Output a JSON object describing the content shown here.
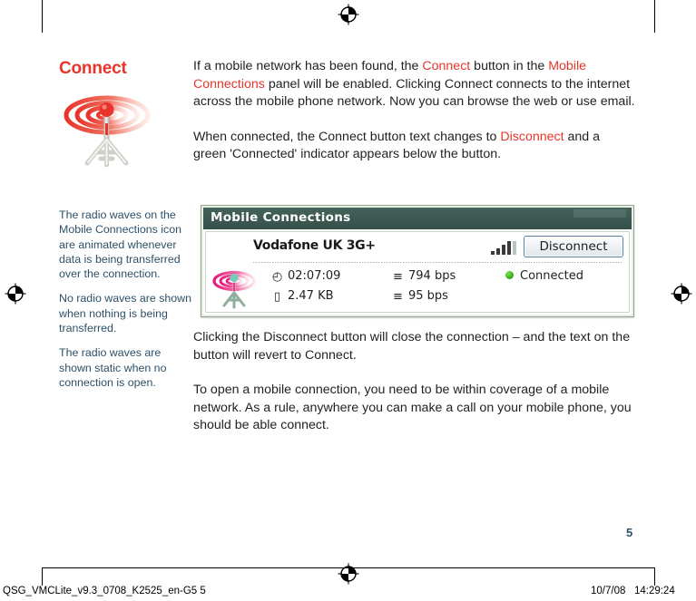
{
  "page": {
    "number": "5",
    "footer_left": "QSG_VMCLite_v9.3_0708_K2525_en-G5   5",
    "footer_right": "10/7/08   14:29:24"
  },
  "section": {
    "heading": "Connect",
    "illustration_icon": "radio-antenna-icon"
  },
  "body": {
    "paragraph1": {
      "part1": "If a mobile network has been found, the ",
      "hl1": "Connect",
      "part2": " button in the ",
      "hl2": "Mobile Connections",
      "part3": " panel will be enabled. Clicking Connect connects to the internet across the mobile phone network. Now you can browse the web or use email."
    },
    "paragraph2": {
      "part1": "When connected, the Connect button text changes to ",
      "hl1": "Disconnect",
      "part2": " and a green 'Connected' indicator appears below the button."
    },
    "paragraph3": "Clicking the Disconnect button will close the connection – and the text on the button will revert to Connect.",
    "paragraph4": "To open a mobile connection, you need to be within coverage of a mobile network. As a rule, anywhere you can make a call on your mobile phone, you should be able connect."
  },
  "side_notes": [
    "The radio waves on the Mobile Connections icon are animated whenever data is being transferred over the connection.",
    "No radio waves are shown when nothing is being transferred.",
    "The radio waves are shown static when no connection is open."
  ],
  "screenshot": {
    "title": "Mobile Connections",
    "network_name": "Vodafone UK 3G+",
    "signal_icon": "signal-bars-icon",
    "signal_strength": 4,
    "signal_total": 5,
    "button_label": "Disconnect",
    "antenna_icon": "mobile-connection-antenna-icon",
    "stats": {
      "duration": {
        "icon": "clock-icon",
        "glyph": "◴",
        "value": "02:07:09"
      },
      "data_volume": {
        "icon": "data-volume-icon",
        "glyph": "▯",
        "value": "2.47 KB"
      },
      "upload_rate": {
        "icon": "upload-icon",
        "glyph": "≡",
        "value": "794 bps"
      },
      "download_rate": {
        "icon": "download-icon",
        "glyph": "≡",
        "value": "95 bps"
      },
      "status": {
        "icon": "status-dot-icon",
        "value": "Connected"
      }
    }
  },
  "colors": {
    "accent_red": "#e8342a",
    "note_blue": "#2d5068",
    "panel_header": "#3c5952",
    "status_green": "#36b016"
  }
}
